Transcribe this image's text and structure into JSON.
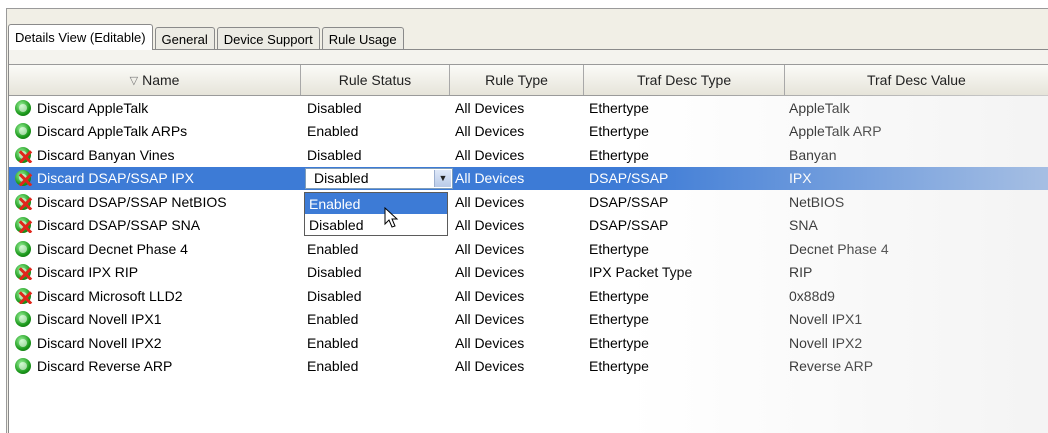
{
  "tabs": [
    {
      "label": "Details View (Editable)",
      "active": true
    },
    {
      "label": "General",
      "active": false
    },
    {
      "label": "Device Support",
      "active": false
    },
    {
      "label": "Rule Usage",
      "active": false
    }
  ],
  "table": {
    "sort_indicator": "▽",
    "columns": [
      "Name",
      "Rule Status",
      "Rule Type",
      "Traf Desc Type",
      "Traf Desc Value"
    ],
    "rows": [
      {
        "icon": "green-status-icon",
        "name": "Discard AppleTalk",
        "status": "Disabled",
        "type": "All Devices",
        "desc_type": "Ethertype",
        "desc_value": "AppleTalk"
      },
      {
        "icon": "green-status-icon",
        "name": "Discard AppleTalk ARPs",
        "status": "Enabled",
        "type": "All Devices",
        "desc_type": "Ethertype",
        "desc_value": "AppleTalk ARP"
      },
      {
        "icon": "red-x-status-icon",
        "name": "Discard Banyan Vines",
        "status": "Disabled",
        "type": "All Devices",
        "desc_type": "Ethertype",
        "desc_value": "Banyan"
      },
      {
        "icon": "red-x-status-icon",
        "name": "Discard DSAP/SSAP IPX",
        "status": "Disabled",
        "type": "All Devices",
        "desc_type": "DSAP/SSAP",
        "desc_value": "IPX",
        "selected": true
      },
      {
        "icon": "red-x-status-icon",
        "name": "Discard DSAP/SSAP NetBIOS",
        "status": "",
        "type": "All Devices",
        "desc_type": "DSAP/SSAP",
        "desc_value": "NetBIOS"
      },
      {
        "icon": "red-x-status-icon",
        "name": "Discard DSAP/SSAP SNA",
        "status": "",
        "type": "All Devices",
        "desc_type": "DSAP/SSAP",
        "desc_value": "SNA"
      },
      {
        "icon": "green-status-icon",
        "name": "Discard Decnet Phase 4",
        "status": "Enabled",
        "type": "All Devices",
        "desc_type": "Ethertype",
        "desc_value": "Decnet Phase 4"
      },
      {
        "icon": "red-x-status-icon",
        "name": "Discard IPX RIP",
        "status": "Disabled",
        "type": "All Devices",
        "desc_type": "IPX Packet Type",
        "desc_value": "RIP"
      },
      {
        "icon": "red-x-status-icon",
        "name": "Discard Microsoft LLD2",
        "status": "Disabled",
        "type": "All Devices",
        "desc_type": "Ethertype",
        "desc_value": "0x88d9"
      },
      {
        "icon": "green-status-icon",
        "name": "Discard Novell IPX1",
        "status": "Enabled",
        "type": "All Devices",
        "desc_type": "Ethertype",
        "desc_value": "Novell IPX1"
      },
      {
        "icon": "green-status-icon",
        "name": "Discard Novell IPX2",
        "status": "Enabled",
        "type": "All Devices",
        "desc_type": "Ethertype",
        "desc_value": "Novell IPX2"
      },
      {
        "icon": "green-status-icon",
        "name": "Discard Reverse ARP",
        "status": "Enabled",
        "type": "All Devices",
        "desc_type": "Ethertype",
        "desc_value": "Reverse ARP"
      }
    ]
  },
  "editor": {
    "value": "Disabled",
    "arrow": "▼",
    "options": [
      "Enabled",
      "Disabled"
    ],
    "highlighted": "Enabled"
  },
  "colors": {
    "selection": "#3d7bd6",
    "enabled_icon": "#1c9a1c",
    "disabled_x": "#e0261b"
  }
}
